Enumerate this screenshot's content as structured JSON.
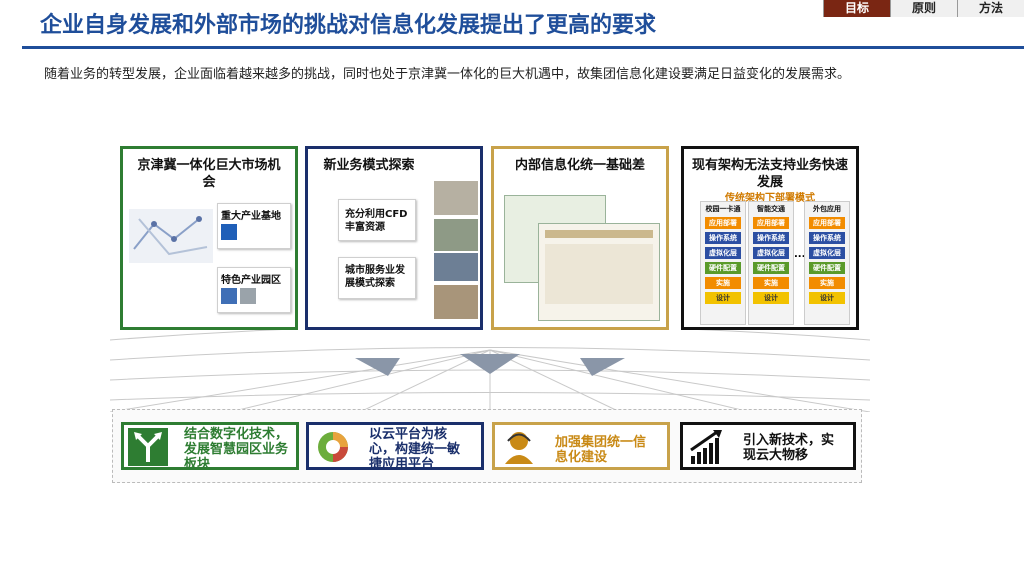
{
  "header": {
    "title": "企业自身发展和外部市场的挑战对信息化发展提出了更高的要求",
    "nav": [
      "目标",
      "原则",
      "方法"
    ]
  },
  "intro": "随着业务的转型发展，企业面临着越来越多的挑战，同时也处于京津冀一体化的巨大机遇中，故集团信息化建设要满足日益变化的发展需求。",
  "cards": [
    {
      "title": "京津冀一体化巨大市场机会",
      "items": [
        "重大产业基地",
        "特色产业园区"
      ]
    },
    {
      "title": "新业务模式探索",
      "items": [
        "充分利用CFD丰富资源",
        "城市服务业发展模式探索"
      ]
    },
    {
      "title": "内部信息化统一基础差"
    },
    {
      "title": "现有架构无法支持业务快速发展",
      "subtitle": "传统架构下部署模式",
      "columns": [
        "校园一卡通",
        "智能交通",
        "外包应用"
      ],
      "ellipsis": "...",
      "layers": [
        "应用部署",
        "操作系统",
        "虚拟化层",
        "硬件配置",
        "实施",
        "设计"
      ]
    }
  ],
  "solutions": [
    {
      "text": "结合数字化技术，发展智慧园区业务板块",
      "color": "#2e7d32",
      "icon": "split-arrows-icon"
    },
    {
      "text": "以云平台为核心，构建统一敏捷应用平台",
      "color": "#1a2f6b",
      "icon": "cloud-cycle-icon"
    },
    {
      "text": "加强集团统一信息化建设",
      "color": "#c8a24a",
      "icon": "support-agent-icon"
    },
    {
      "text": "引入新技术，实现云大物移",
      "color": "#111111",
      "icon": "growth-bars-icon"
    }
  ],
  "colors": {
    "brand": "#1f4e9a",
    "active_tab": "#7a2613"
  }
}
